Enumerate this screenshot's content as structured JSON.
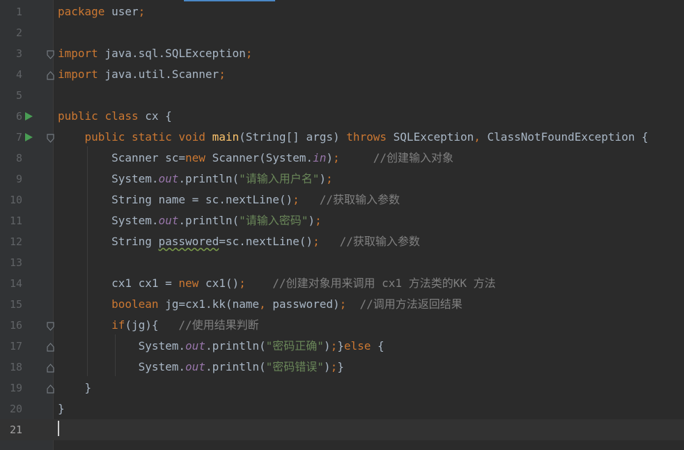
{
  "editor": {
    "language": "java",
    "current_line": "21",
    "lines": [
      {
        "number": "1",
        "segments": [
          {
            "t": "package",
            "k": "kw"
          },
          {
            "t": " user",
            "k": ""
          },
          {
            "t": ";",
            "k": "kw"
          }
        ]
      },
      {
        "number": "2",
        "segments": []
      },
      {
        "number": "3",
        "segments": [
          {
            "t": "import",
            "k": "kw"
          },
          {
            "t": " java.sql.SQLException",
            "k": ""
          },
          {
            "t": ";",
            "k": "kw"
          }
        ]
      },
      {
        "number": "4",
        "segments": [
          {
            "t": "import",
            "k": "kw"
          },
          {
            "t": " java.util.Scanner",
            "k": ""
          },
          {
            "t": ";",
            "k": "kw"
          }
        ]
      },
      {
        "number": "5",
        "segments": []
      },
      {
        "number": "6",
        "segments": [
          {
            "t": "public",
            "k": "kw"
          },
          {
            "t": " ",
            "k": ""
          },
          {
            "t": "class",
            "k": "kw"
          },
          {
            "t": " cx {",
            "k": ""
          }
        ]
      },
      {
        "number": "7",
        "segments": [
          {
            "t": "    ",
            "k": ""
          },
          {
            "t": "public",
            "k": "kw"
          },
          {
            "t": " ",
            "k": ""
          },
          {
            "t": "static",
            "k": "kw"
          },
          {
            "t": " ",
            "k": ""
          },
          {
            "t": "void",
            "k": "kw"
          },
          {
            "t": " ",
            "k": ""
          },
          {
            "t": "main",
            "k": "fn"
          },
          {
            "t": "(String[] args) ",
            "k": ""
          },
          {
            "t": "throws",
            "k": "kw"
          },
          {
            "t": " SQLException",
            "k": ""
          },
          {
            "t": ",",
            "k": "kw"
          },
          {
            "t": " ClassNotFoundException {",
            "k": ""
          }
        ]
      },
      {
        "number": "8",
        "segments": [
          {
            "t": "        Scanner sc=",
            "k": ""
          },
          {
            "t": "new",
            "k": "kw"
          },
          {
            "t": " Scanner(System.",
            "k": ""
          },
          {
            "t": "in",
            "k": "st"
          },
          {
            "t": ")",
            "k": ""
          },
          {
            "t": ";",
            "k": "kw"
          },
          {
            "t": "     ",
            "k": ""
          },
          {
            "t": "//创建输入对象",
            "k": "cm"
          }
        ]
      },
      {
        "number": "9",
        "segments": [
          {
            "t": "        System.",
            "k": ""
          },
          {
            "t": "out",
            "k": "st"
          },
          {
            "t": ".println(",
            "k": ""
          },
          {
            "t": "\"请输入用户名\"",
            "k": "str"
          },
          {
            "t": ")",
            "k": ""
          },
          {
            "t": ";",
            "k": "kw"
          }
        ]
      },
      {
        "number": "10",
        "segments": [
          {
            "t": "        String name = sc.nextLine()",
            "k": ""
          },
          {
            "t": ";",
            "k": "kw"
          },
          {
            "t": "   ",
            "k": ""
          },
          {
            "t": "//获取输入参数",
            "k": "cm"
          }
        ]
      },
      {
        "number": "11",
        "segments": [
          {
            "t": "        System.",
            "k": ""
          },
          {
            "t": "out",
            "k": "st"
          },
          {
            "t": ".println(",
            "k": ""
          },
          {
            "t": "\"请输入密码\"",
            "k": "str"
          },
          {
            "t": ")",
            "k": ""
          },
          {
            "t": ";",
            "k": "kw"
          }
        ]
      },
      {
        "number": "12",
        "segments": [
          {
            "t": "        String ",
            "k": ""
          },
          {
            "t": "passwored",
            "k": "un"
          },
          {
            "t": "=sc.nextLine()",
            "k": ""
          },
          {
            "t": ";",
            "k": "kw"
          },
          {
            "t": "   ",
            "k": ""
          },
          {
            "t": "//获取输入参数",
            "k": "cm"
          }
        ]
      },
      {
        "number": "13",
        "segments": []
      },
      {
        "number": "14",
        "segments": [
          {
            "t": "        cx1 cx1 = ",
            "k": ""
          },
          {
            "t": "new",
            "k": "kw"
          },
          {
            "t": " cx1()",
            "k": ""
          },
          {
            "t": ";",
            "k": "kw"
          },
          {
            "t": "    ",
            "k": ""
          },
          {
            "t": "//创建对象用来调用 cx1 方法类的KK 方法",
            "k": "cm"
          }
        ]
      },
      {
        "number": "15",
        "segments": [
          {
            "t": "        ",
            "k": ""
          },
          {
            "t": "boolean",
            "k": "kw"
          },
          {
            "t": " jg=cx1.kk(name",
            "k": ""
          },
          {
            "t": ",",
            "k": "kw"
          },
          {
            "t": " passwored)",
            "k": ""
          },
          {
            "t": ";",
            "k": "kw"
          },
          {
            "t": "  ",
            "k": ""
          },
          {
            "t": "//调用方法返回结果",
            "k": "cm"
          }
        ]
      },
      {
        "number": "16",
        "segments": [
          {
            "t": "        ",
            "k": ""
          },
          {
            "t": "if",
            "k": "kw"
          },
          {
            "t": "(jg){   ",
            "k": ""
          },
          {
            "t": "//使用结果判断",
            "k": "cm"
          }
        ]
      },
      {
        "number": "17",
        "segments": [
          {
            "t": "            System.",
            "k": ""
          },
          {
            "t": "out",
            "k": "st"
          },
          {
            "t": ".println(",
            "k": ""
          },
          {
            "t": "\"密码正确\"",
            "k": "str"
          },
          {
            "t": ")",
            "k": ""
          },
          {
            "t": ";",
            "k": "kw"
          },
          {
            "t": "}",
            "k": ""
          },
          {
            "t": "else",
            "k": "kw"
          },
          {
            "t": " {",
            "k": ""
          }
        ]
      },
      {
        "number": "18",
        "segments": [
          {
            "t": "            System.",
            "k": ""
          },
          {
            "t": "out",
            "k": "st"
          },
          {
            "t": ".println(",
            "k": ""
          },
          {
            "t": "\"密码错误\"",
            "k": "str"
          },
          {
            "t": ")",
            "k": ""
          },
          {
            "t": ";",
            "k": "kw"
          },
          {
            "t": "}",
            "k": ""
          }
        ]
      },
      {
        "number": "19",
        "segments": [
          {
            "t": "    }",
            "k": ""
          }
        ]
      },
      {
        "number": "20",
        "segments": [
          {
            "t": "}",
            "k": ""
          }
        ]
      },
      {
        "number": "21",
        "segments": []
      }
    ],
    "gutter_icons": {
      "run_lines": [
        "6",
        "7"
      ],
      "fold_lines": [
        {
          "line": "3",
          "kind": "fold-start"
        },
        {
          "line": "4",
          "kind": "fold-end"
        },
        {
          "line": "7",
          "kind": "fold-start"
        },
        {
          "line": "16",
          "kind": "fold-start"
        },
        {
          "line": "17",
          "kind": "fold-mid"
        },
        {
          "line": "18",
          "kind": "fold-end"
        },
        {
          "line": "19",
          "kind": "fold-end"
        }
      ]
    },
    "colors": {
      "background": "#2b2b2b",
      "gutter": "#313335",
      "keyword": "#cc7832",
      "method": "#ffc66d",
      "string": "#6a8759",
      "comment": "#808080",
      "static_field": "#9876aa",
      "plain": "#a9b7c6",
      "run_icon": "#499c54"
    }
  }
}
